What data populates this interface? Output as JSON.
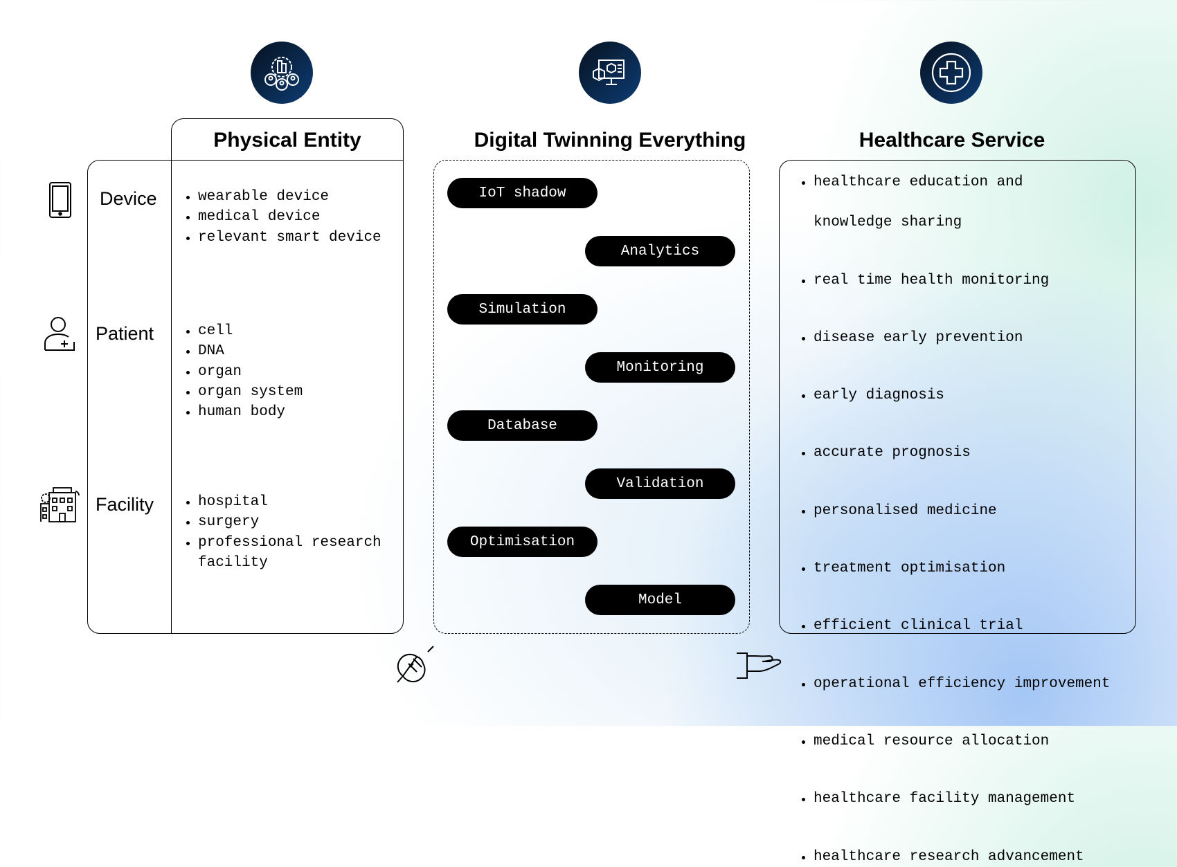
{
  "columns": {
    "physical": {
      "title": "Physical Entity",
      "icon": "city-people-gear-icon"
    },
    "digital": {
      "title": "Digital Twinning Everything",
      "icon": "digital-twin-monitor-icon"
    },
    "healthcare": {
      "title": "Healthcare Service",
      "icon": "medical-cross-icon"
    }
  },
  "physical_rows": [
    {
      "label": "Device",
      "icon": "smartphone-icon",
      "items": [
        "wearable device",
        "medical device",
        "relevant smart device"
      ]
    },
    {
      "label": "Patient",
      "icon": "patient-icon",
      "items": [
        "cell",
        "DNA",
        "organ",
        "organ system",
        "human body"
      ]
    },
    {
      "label": "Facility",
      "icon": "hospital-building-icon",
      "items": [
        "hospital",
        "surgery",
        "professional research",
        "facility"
      ]
    }
  ],
  "digital_steps": [
    "IoT shadow",
    "Analytics",
    "Simulation",
    "Monitoring",
    "Database",
    "Validation",
    "Optimisation",
    "Model"
  ],
  "healthcare_services": [
    "healthcare education and",
    "knowledge sharing",
    "real time health monitoring",
    "disease early prevention",
    "early diagnosis",
    "accurate prognosis",
    "personalised medicine",
    "treatment optimisation",
    "efficient clinical trial",
    "operational efficiency improvement",
    "medical resource allocation",
    "healthcare facility management",
    "healthcare research advancement"
  ],
  "connectors": {
    "left": "plug-icon",
    "right": "hand-offering-icon"
  },
  "colors": {
    "icon_circle": "#0b2b52",
    "pill": "#000000",
    "bg_blue": "#a0c4f5",
    "bg_mint": "#cdf0e4"
  }
}
